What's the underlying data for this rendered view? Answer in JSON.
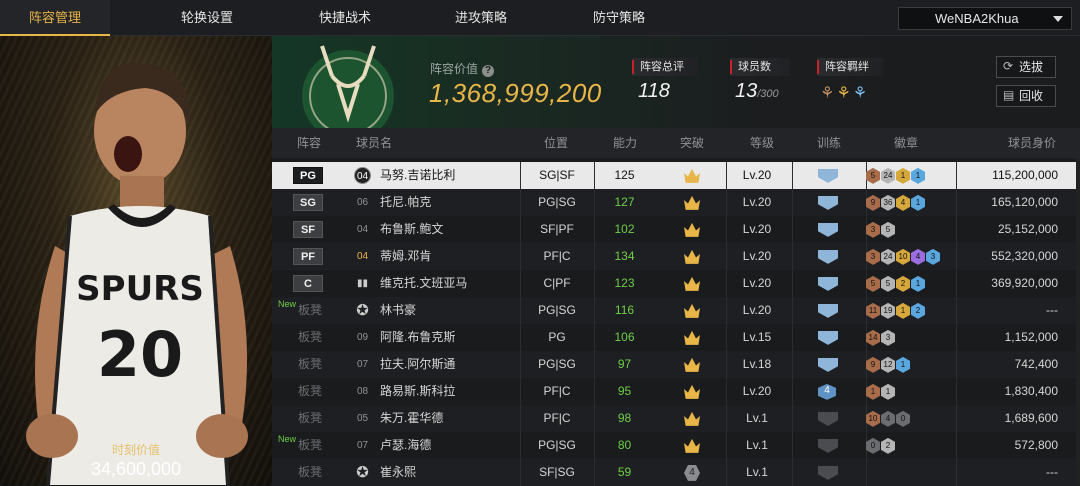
{
  "nav": {
    "tabs": [
      "阵容管理",
      "轮换设置",
      "快捷战术",
      "进攻策略",
      "防守策略"
    ],
    "user": "WeNBA2Khua"
  },
  "player_card": {
    "jersey_team": "SPURS",
    "jersey_number": "20",
    "market_label": "时刻价值",
    "market_value": "34,600,000"
  },
  "summary": {
    "lineup_value_label": "阵容价值",
    "lineup_value": "1,368,999,200",
    "overall_label": "阵容总评",
    "overall_value": "118",
    "count_label": "球员数",
    "count_value": "13",
    "count_max": "/300",
    "bond_label": "阵容羁绊",
    "select_button": "选拔",
    "recycle_button": "回收"
  },
  "table": {
    "headers": [
      "阵容",
      "球员名",
      "位置",
      "能力",
      "突破",
      "等级",
      "训练",
      "徽章",
      "球员身价"
    ],
    "rows": [
      {
        "slot": "PG",
        "bench": false,
        "new": false,
        "num": "04",
        "num_style": "hex",
        "name": "马努.吉诺比利",
        "pos": "SG|SF",
        "ability": "125",
        "breakthrough": "crown",
        "level": "Lv.20",
        "train": "blue",
        "badges": [
          [
            "b-bronze",
            "5"
          ],
          [
            "b-silver",
            "24"
          ],
          [
            "b-gold",
            "1"
          ],
          [
            "b-blue",
            "1"
          ]
        ],
        "salary": "115,200,000"
      },
      {
        "slot": "SG",
        "bench": false,
        "new": false,
        "num": "06",
        "num_style": "plain",
        "name": "托尼.帕克",
        "pos": "PG|SG",
        "ability": "127",
        "breakthrough": "crown",
        "level": "Lv.20",
        "train": "blue",
        "badges": [
          [
            "b-bronze",
            "9"
          ],
          [
            "b-silver",
            "36"
          ],
          [
            "b-gold",
            "4"
          ],
          [
            "b-blue",
            "1"
          ]
        ],
        "salary": "165,120,000"
      },
      {
        "slot": "SF",
        "bench": false,
        "new": false,
        "num": "04",
        "num_style": "plain",
        "name": "布鲁斯.鲍文",
        "pos": "SF|PF",
        "ability": "102",
        "breakthrough": "crown",
        "level": "Lv.20",
        "train": "blue",
        "badges": [
          [
            "b-bronze",
            "3"
          ],
          [
            "b-silver",
            "5"
          ]
        ],
        "salary": "25,152,000"
      },
      {
        "slot": "PF",
        "bench": false,
        "new": false,
        "num": "04",
        "num_style": "gold",
        "name": "蒂姆.邓肯",
        "pos": "PF|C",
        "ability": "134",
        "breakthrough": "crown",
        "level": "Lv.20",
        "train": "blue",
        "badges": [
          [
            "b-bronze",
            "3"
          ],
          [
            "b-silver",
            "24"
          ],
          [
            "b-gold",
            "10"
          ],
          [
            "b-purple",
            "4"
          ],
          [
            "b-blue",
            "3"
          ]
        ],
        "salary": "552,320,000"
      },
      {
        "slot": "C",
        "bench": false,
        "new": false,
        "num": "",
        "num_style": "bars",
        "name": "维克托.文班亚马",
        "pos": "C|PF",
        "ability": "123",
        "breakthrough": "crown",
        "level": "Lv.20",
        "train": "blue",
        "badges": [
          [
            "b-bronze",
            "5"
          ],
          [
            "b-silver",
            "5"
          ],
          [
            "b-gold",
            "2"
          ],
          [
            "b-blue",
            "1"
          ]
        ],
        "salary": "369,920,000"
      },
      {
        "slot": "板凳",
        "bench": true,
        "new": true,
        "num": "",
        "num_style": "star",
        "name": "林书豪",
        "pos": "PG|SG",
        "ability": "116",
        "breakthrough": "crown",
        "level": "Lv.20",
        "train": "blue",
        "badges": [
          [
            "b-bronze",
            "11"
          ],
          [
            "b-silver",
            "19"
          ],
          [
            "b-gold",
            "1"
          ],
          [
            "b-blue",
            "2"
          ]
        ],
        "salary": "---"
      },
      {
        "slot": "板凳",
        "bench": true,
        "new": false,
        "num": "09",
        "num_style": "plain",
        "name": "阿隆.布鲁克斯",
        "pos": "PG",
        "ability": "106",
        "breakthrough": "crown",
        "level": "Lv.15",
        "train": "blue",
        "badges": [
          [
            "b-bronze",
            "14"
          ],
          [
            "b-silver",
            "3"
          ]
        ],
        "salary": "1,152,000"
      },
      {
        "slot": "板凳",
        "bench": true,
        "new": false,
        "num": "07",
        "num_style": "plain",
        "name": "拉夫.阿尔斯通",
        "pos": "PG|SG",
        "ability": "97",
        "breakthrough": "crown",
        "level": "Lv.18",
        "train": "blue",
        "badges": [
          [
            "b-bronze",
            "9"
          ],
          [
            "b-silver",
            "12"
          ],
          [
            "b-blue",
            "1"
          ]
        ],
        "salary": "742,400"
      },
      {
        "slot": "板凳",
        "bench": true,
        "new": false,
        "num": "08",
        "num_style": "plain",
        "name": "路易斯.斯科拉",
        "pos": "PF|C",
        "ability": "95",
        "breakthrough": "crown",
        "level": "Lv.20",
        "train": "num4",
        "badges": [
          [
            "b-bronze",
            "1"
          ],
          [
            "b-silver",
            "1"
          ]
        ],
        "salary": "1,830,400"
      },
      {
        "slot": "板凳",
        "bench": true,
        "new": false,
        "num": "05",
        "num_style": "plain",
        "name": "朱万.霍华德",
        "pos": "PF|C",
        "ability": "98",
        "breakthrough": "crown",
        "level": "Lv.1",
        "train": "grey",
        "badges": [
          [
            "b-bronze",
            "10"
          ],
          [
            "b-dark",
            "4"
          ],
          [
            "b-dark",
            "0"
          ]
        ],
        "salary": "1,689,600"
      },
      {
        "slot": "板凳",
        "bench": true,
        "new": true,
        "num": "07",
        "num_style": "plain",
        "name": "卢瑟.海德",
        "pos": "PG|SG",
        "ability": "80",
        "breakthrough": "crown",
        "level": "Lv.1",
        "train": "grey",
        "badges": [
          [
            "b-dark",
            "0"
          ],
          [
            "b-silver",
            "2"
          ]
        ],
        "salary": "572,800"
      },
      {
        "slot": "板凳",
        "bench": true,
        "new": false,
        "num": "",
        "num_style": "star",
        "name": "崔永熙",
        "pos": "SF|SG",
        "ability": "59",
        "breakthrough": "grey4",
        "level": "Lv.1",
        "train": "grey",
        "badges": [],
        "salary": "---"
      }
    ]
  },
  "colors": {
    "accent": "#e8b548",
    "green": "#6fcf4a",
    "red_marker": "#c8232a"
  },
  "icons": [
    "help-icon",
    "refresh-icon",
    "recycle-icon",
    "caret-down-icon",
    "bond-icon",
    "crown-icon",
    "training-icon",
    "badge-icon",
    "star-icon",
    "bars-icon",
    "bucks-logo"
  ]
}
